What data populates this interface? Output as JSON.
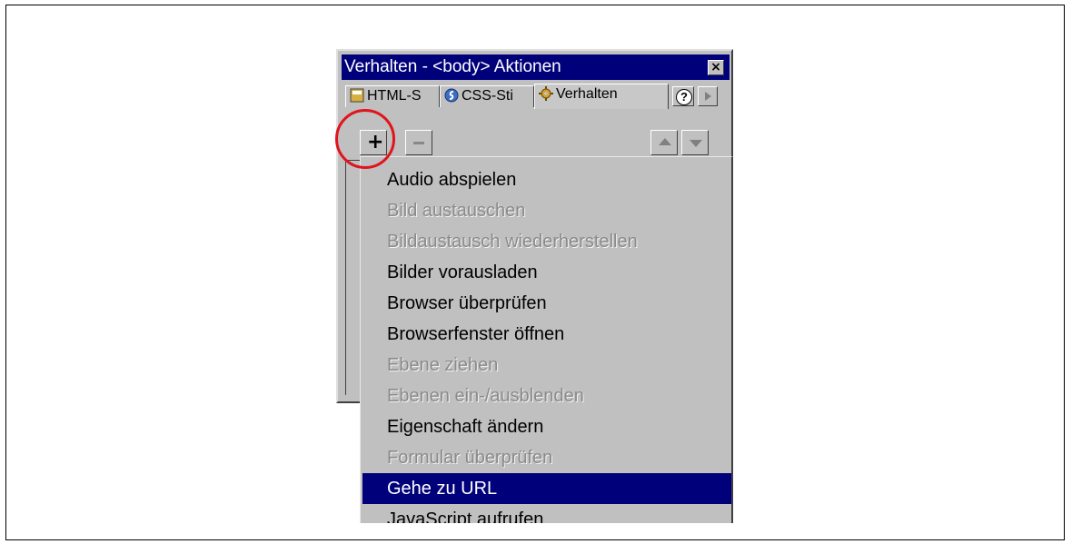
{
  "panel": {
    "title": "Verhalten - <body> Aktionen",
    "close_symbol": "×",
    "tabs": [
      {
        "label": "HTML-S",
        "icon": "html-styles-icon"
      },
      {
        "label": "CSS-Sti",
        "icon": "css-styles-icon"
      },
      {
        "label": "Verhalten",
        "icon": "behaviors-gear-icon",
        "active": true
      }
    ],
    "help_symbol": "?",
    "toolbar": {
      "add_symbol": "+",
      "add_icon": "plus-icon",
      "remove_icon": "minus-icon",
      "up_icon": "up-arrow-icon",
      "down_icon": "down-arrow-icon"
    }
  },
  "menu": {
    "items": [
      {
        "label": "Audio abspielen",
        "enabled": true
      },
      {
        "label": "Bild austauschen",
        "enabled": false
      },
      {
        "label": "Bildaustausch wiederherstellen",
        "enabled": false
      },
      {
        "label": "Bilder vorausladen",
        "enabled": true
      },
      {
        "label": "Browser überprüfen",
        "enabled": true
      },
      {
        "label": "Browserfenster öffnen",
        "enabled": true
      },
      {
        "label": "Ebene ziehen",
        "enabled": false
      },
      {
        "label": "Ebenen ein-/ausblenden",
        "enabled": false
      },
      {
        "label": "Eigenschaft ändern",
        "enabled": true
      },
      {
        "label": "Formular überprüfen",
        "enabled": false
      },
      {
        "label": "Gehe zu URL",
        "enabled": true,
        "selected": true
      },
      {
        "label": "JavaScript aufrufen",
        "enabled": true
      }
    ]
  },
  "colors": {
    "titlebar": "#00007b",
    "panel_bg": "#c0c0c0",
    "highlight_circle": "#e0141e",
    "disabled_text": "#8a8a8a"
  }
}
